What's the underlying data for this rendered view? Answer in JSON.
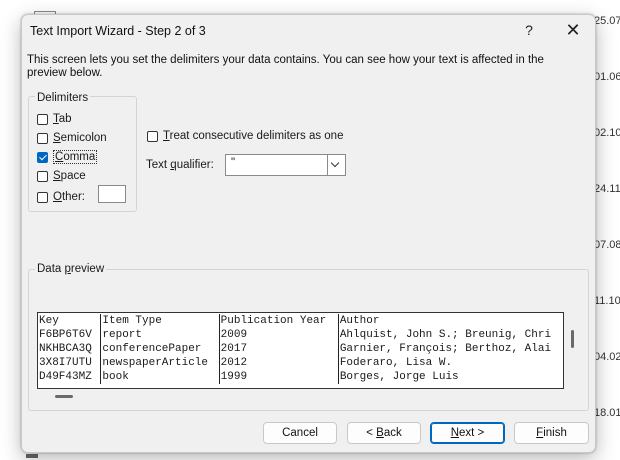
{
  "background": {
    "cells": [
      "25.07",
      "01.06",
      "02.10",
      "24.11",
      "07.08",
      "11.10",
      "04.02",
      "18.01"
    ]
  },
  "dialog": {
    "title": "Text Import Wizard - Step 2 of 3",
    "help_label": "?",
    "close_label": "✕",
    "description": "This screen lets you set the delimiters your data contains.  You can see how your text is affected in the preview below.",
    "delimiters": {
      "legend": "Delimiters",
      "tab": {
        "label": "Tab",
        "checked": false
      },
      "semicolon": {
        "label": "Semicolon",
        "checked": false
      },
      "comma": {
        "label": "Comma",
        "checked": true
      },
      "space": {
        "label": "Space",
        "checked": false
      },
      "other": {
        "label": "Other:",
        "checked": false,
        "value": ""
      }
    },
    "consecutive": {
      "label": "Treat consecutive delimiters as one",
      "checked": false
    },
    "text_qualifier": {
      "label": "Text qualifier:",
      "value": "\""
    },
    "preview": {
      "legend": "Data preview",
      "rows": [
        [
          "Key",
          "Item Type",
          "Publication Year",
          "Author"
        ],
        [
          "F6BP6T6V",
          "report",
          "2009",
          "Ahlquist, John S.; Breunig, Chri"
        ],
        [
          "NKHBCA3Q",
          "conferencePaper",
          "2017",
          "Garnier, François; Berthoz, Alai"
        ],
        [
          "3X8I7UTU",
          "newspaperArticle",
          "2012",
          "Foderaro, Lisa W."
        ],
        [
          "D49F43MZ",
          "book",
          "1999",
          "Borges, Jorge Luis"
        ]
      ]
    },
    "buttons": {
      "cancel": "Cancel",
      "back": "< Back",
      "next": "Next >",
      "finish": "Finish"
    }
  }
}
